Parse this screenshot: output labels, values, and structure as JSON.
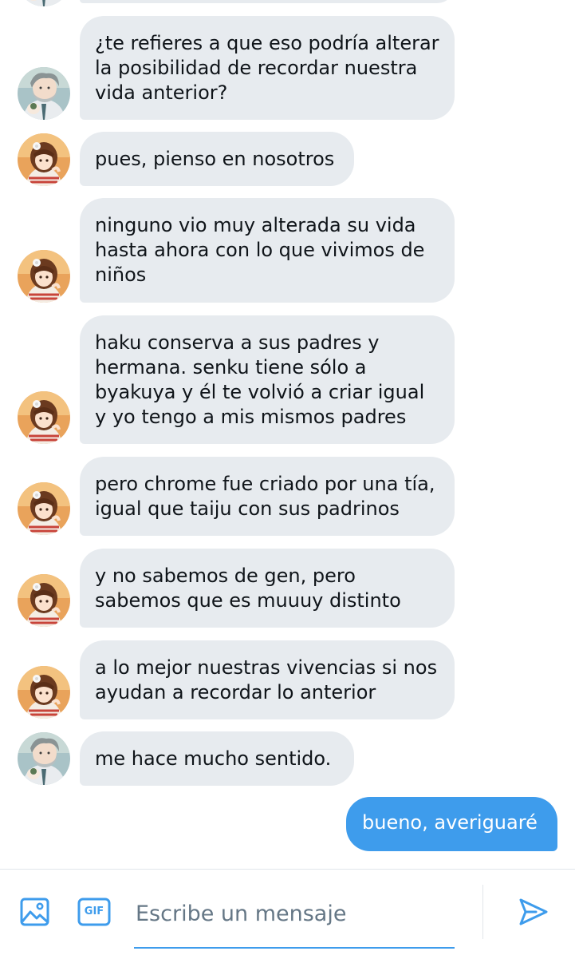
{
  "conversation": {
    "messages": [
      {
        "sender": "other",
        "avatar": "elder",
        "text": "¿te refieres a que eso podría alterar la posibilidad de recordar nuestra vida anterior?"
      },
      {
        "sender": "other",
        "avatar": "girl",
        "text": "pues, pienso en nosotros"
      },
      {
        "sender": "other",
        "avatar": "girl",
        "text": "ninguno vio muy alterada su vida hasta ahora con lo que vivimos de niños"
      },
      {
        "sender": "other",
        "avatar": "girl",
        "text": "haku conserva a sus padres y hermana. senku tiene sólo a byakuya y él te volvió a criar igual y yo tengo a mis mismos padres"
      },
      {
        "sender": "other",
        "avatar": "girl",
        "text": "pero chrome fue criado por una tía, igual que taiju con sus padrinos"
      },
      {
        "sender": "other",
        "avatar": "girl",
        "text": "y no sabemos de gen, pero sabemos que es muuuy distinto"
      },
      {
        "sender": "other",
        "avatar": "girl",
        "text": "a lo mejor nuestras vivencias si nos ayudan a recordar lo anterior"
      },
      {
        "sender": "other",
        "avatar": "elder",
        "text": "me hace mucho sentido."
      },
      {
        "sender": "me",
        "text": "bueno, averiguaré"
      }
    ]
  },
  "composer": {
    "placeholder": "Escribe un mensaje",
    "gif_label": "GIF",
    "icons": {
      "media": "image-icon",
      "gif": "gif-icon",
      "send": "send-icon"
    }
  },
  "colors": {
    "received_bubble": "#e7ebef",
    "sent_bubble": "#3e9cec",
    "accent": "#3e9cec",
    "text": "#0f1419"
  }
}
